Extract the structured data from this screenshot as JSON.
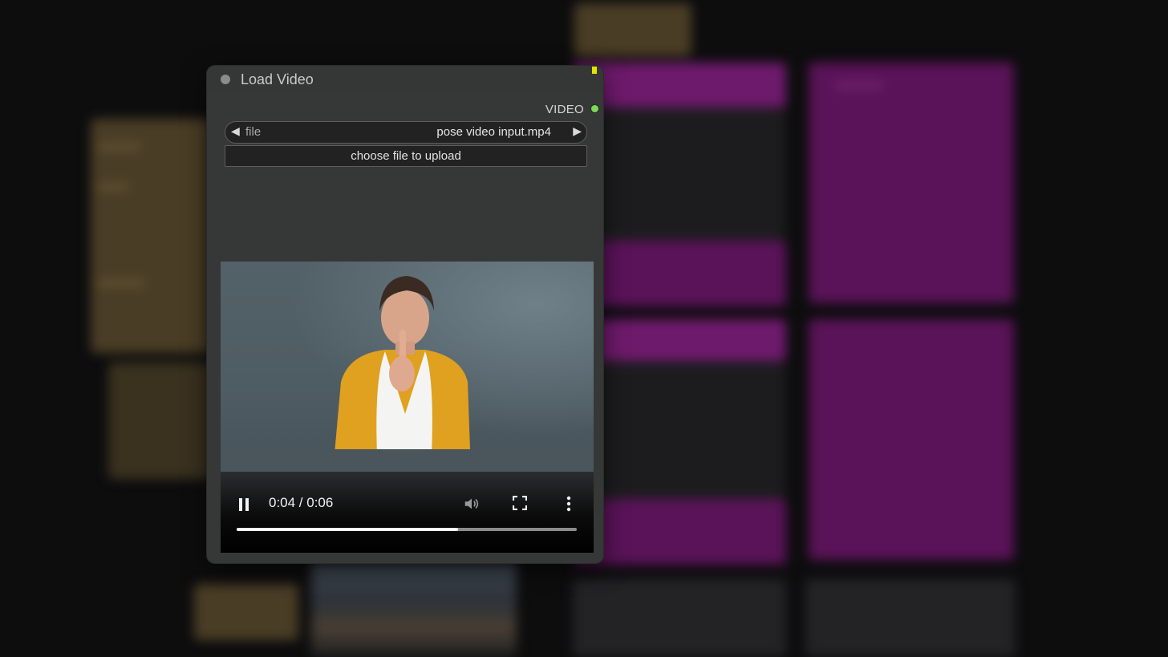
{
  "node": {
    "title": "Load Video",
    "output_label": "VIDEO",
    "file_widget": {
      "label": "file",
      "value": "pose video input.mp4"
    },
    "upload_label": "choose file to upload"
  },
  "video_player": {
    "time_display": "0:04 / 0:06",
    "progress_fraction": 0.65,
    "state": "playing"
  },
  "colors": {
    "node_bg": "#363737",
    "output_dot": "#7ed957",
    "badge": "#e6e000",
    "bg_purple_node": "#5a1358",
    "bg_brown_node": "#4a3d25"
  },
  "icons": [
    "collapse-dot-icon",
    "arrow-left-icon",
    "arrow-right-icon",
    "pause-icon",
    "volume-icon",
    "fullscreen-icon",
    "more-vert-icon"
  ]
}
